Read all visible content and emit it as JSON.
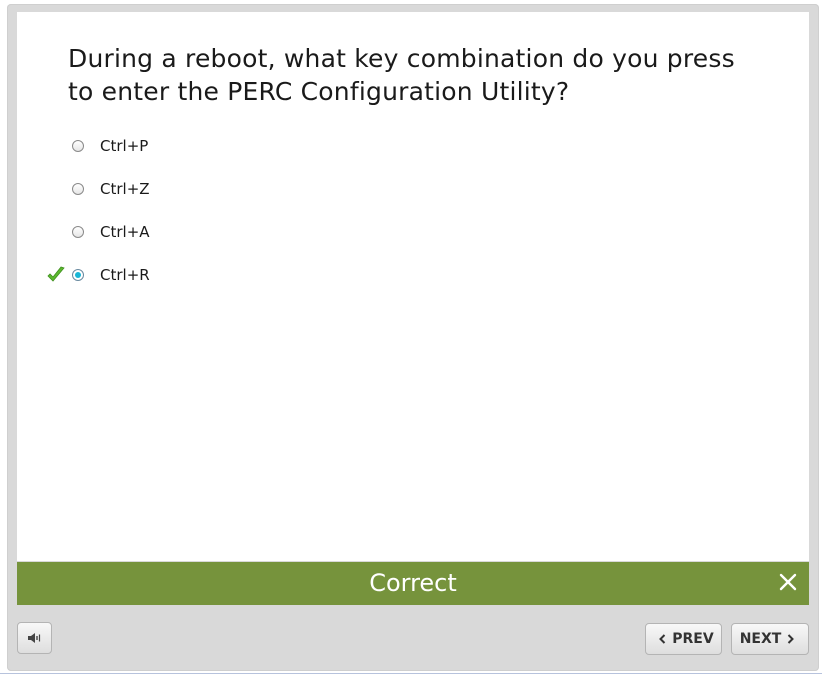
{
  "question": {
    "text": "During a reboot, what key combination do you press to enter the PERC Configuration Utility?"
  },
  "options": [
    {
      "label": "Ctrl+P",
      "selected": false,
      "correct_mark": false
    },
    {
      "label": "Ctrl+Z",
      "selected": false,
      "correct_mark": false
    },
    {
      "label": "Ctrl+A",
      "selected": false,
      "correct_mark": false
    },
    {
      "label": "Ctrl+R",
      "selected": true,
      "correct_mark": true
    }
  ],
  "feedback": {
    "text": "Correct",
    "color": "#76933c"
  },
  "nav": {
    "prev_label": "PREV",
    "next_label": "NEXT"
  },
  "icons": {
    "audio": "speaker-icon",
    "close": "close-icon",
    "check": "checkmark-icon",
    "prev": "chevron-left-icon",
    "next": "chevron-right-icon"
  },
  "colors": {
    "selected_radio": "#19b6d6",
    "checkmark": "#5cb82e"
  }
}
